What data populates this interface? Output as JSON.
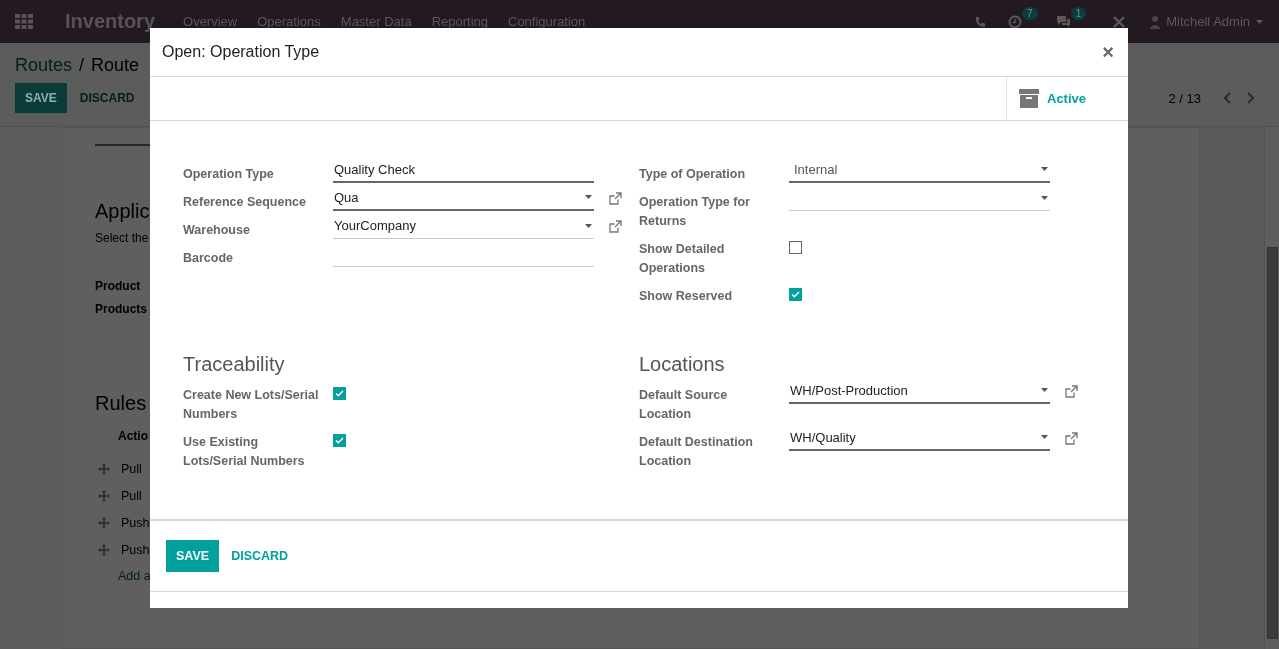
{
  "navbar": {
    "app_title": "Inventory",
    "menu": [
      "Overview",
      "Operations",
      "Master Data",
      "Reporting",
      "Configuration"
    ],
    "activity_count": "7",
    "message_count": "1",
    "user": "Mitchell Admin"
  },
  "control_panel": {
    "breadcrumb": "Routes",
    "breadcrumb_separator": "/",
    "current": "Route",
    "buttons": [
      "SAVE",
      "DISCARD"
    ],
    "pager": "2 / 13"
  },
  "background_form": {
    "section_title": "Applic",
    "hint": "Select the",
    "fields": [
      "Product",
      "Products"
    ],
    "rules_title": "Rules",
    "rules_column": "Actio",
    "rules": [
      "Pull",
      "Pull",
      "Push",
      "Push"
    ],
    "add_line": "Add a"
  },
  "dialog": {
    "title": "Open: Operation Type",
    "close": "×",
    "status_button": "Active",
    "groups": [
      {
        "fields": [
          {
            "kind": "text",
            "label": "Operation Type",
            "value": "Quality Check",
            "required": true
          },
          {
            "kind": "select",
            "label": "Reference Sequence",
            "value": "Qua",
            "required": true,
            "link": true
          },
          {
            "kind": "select",
            "label": "Warehouse",
            "value": "YourCompany",
            "required": false,
            "link": true
          },
          {
            "kind": "text",
            "label": "Barcode",
            "required": false
          }
        ]
      },
      {
        "fields": [
          {
            "kind": "select",
            "label": "Type of Operation",
            "value": "Internal",
            "required": true,
            "link": false
          },
          {
            "kind": "select",
            "label": "Operation Type for Returns",
            "required": false,
            "link": false
          },
          {
            "kind": "checkbox",
            "label": "Show Detailed Operations",
            "checked": false
          },
          {
            "kind": "checkbox",
            "label": "Show Reserved",
            "checked": true
          }
        ]
      },
      {
        "title": "Traceability",
        "fields": [
          {
            "kind": "checkbox",
            "label": "Create New Lots/Serial Numbers",
            "checked": true
          },
          {
            "kind": "checkbox",
            "label": "Use Existing Lots/Serial Numbers",
            "checked": true
          }
        ]
      },
      {
        "title": "Locations",
        "fields": [
          {
            "kind": "select",
            "label": "Default Source Location",
            "value": "WH/Post-Production",
            "required": true,
            "link": true
          },
          {
            "kind": "select",
            "label": "Default Destination Location",
            "value": "WH/Quality",
            "required": true,
            "link": true
          }
        ]
      }
    ],
    "footer_buttons": [
      "SAVE",
      "DISCARD"
    ]
  }
}
